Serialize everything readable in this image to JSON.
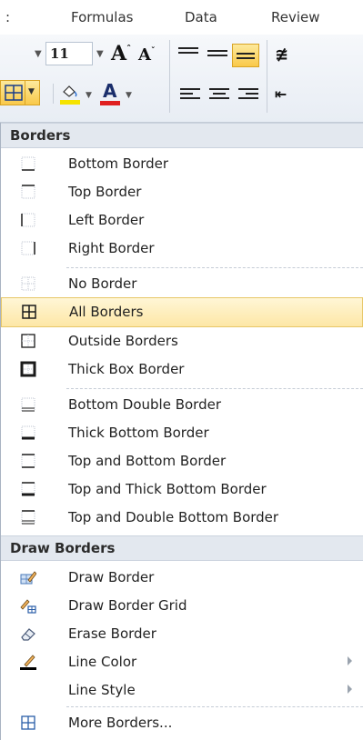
{
  "ribbon": {
    "tabs": [
      ":",
      "Formulas",
      "Data",
      "Review"
    ],
    "font_size_value": "11",
    "grow_font_glyph": "A",
    "shrink_font_glyph": "A",
    "font_color_glyph": "A"
  },
  "colors": {
    "highlight": "#fde7a6",
    "highlight_border": "#e7c768",
    "font_color_bar": "#e02020",
    "fill_color_bar": "#f5e300"
  },
  "menu": {
    "sections": [
      {
        "header": "Borders",
        "items": [
          {
            "label": "Bottom Border",
            "icon": "bottom-border-icon"
          },
          {
            "label": "Top Border",
            "icon": "top-border-icon"
          },
          {
            "label": "Left Border",
            "icon": "left-border-icon"
          },
          {
            "label": "Right Border",
            "icon": "right-border-icon"
          },
          {
            "label": "No Border",
            "icon": "no-border-icon"
          },
          {
            "label": "All Borders",
            "icon": "all-borders-icon",
            "selected": true
          },
          {
            "label": "Outside Borders",
            "icon": "outside-borders-icon"
          },
          {
            "label": "Thick Box Border",
            "icon": "thick-box-border-icon"
          },
          {
            "label": "Bottom Double Border",
            "icon": "bottom-double-border-icon"
          },
          {
            "label": "Thick Bottom Border",
            "icon": "thick-bottom-border-icon"
          },
          {
            "label": "Top and Bottom Border",
            "icon": "top-and-bottom-border-icon"
          },
          {
            "label": "Top and Thick Bottom Border",
            "icon": "top-and-thick-bottom-border-icon"
          },
          {
            "label": "Top and Double Bottom Border",
            "icon": "top-and-double-bottom-border-icon"
          }
        ]
      },
      {
        "header": "Draw Borders",
        "items": [
          {
            "label": "Draw Border",
            "icon": "draw-border-pencil-icon"
          },
          {
            "label": "Draw Border Grid",
            "icon": "draw-border-grid-icon"
          },
          {
            "label": "Erase Border",
            "icon": "eraser-icon"
          },
          {
            "label": "Line Color",
            "icon": "line-color-pencil-icon",
            "submenu": true
          },
          {
            "label": "Line Style",
            "icon": "",
            "submenu": true
          },
          {
            "label": "More Borders...",
            "icon": "more-borders-icon"
          }
        ]
      }
    ]
  }
}
